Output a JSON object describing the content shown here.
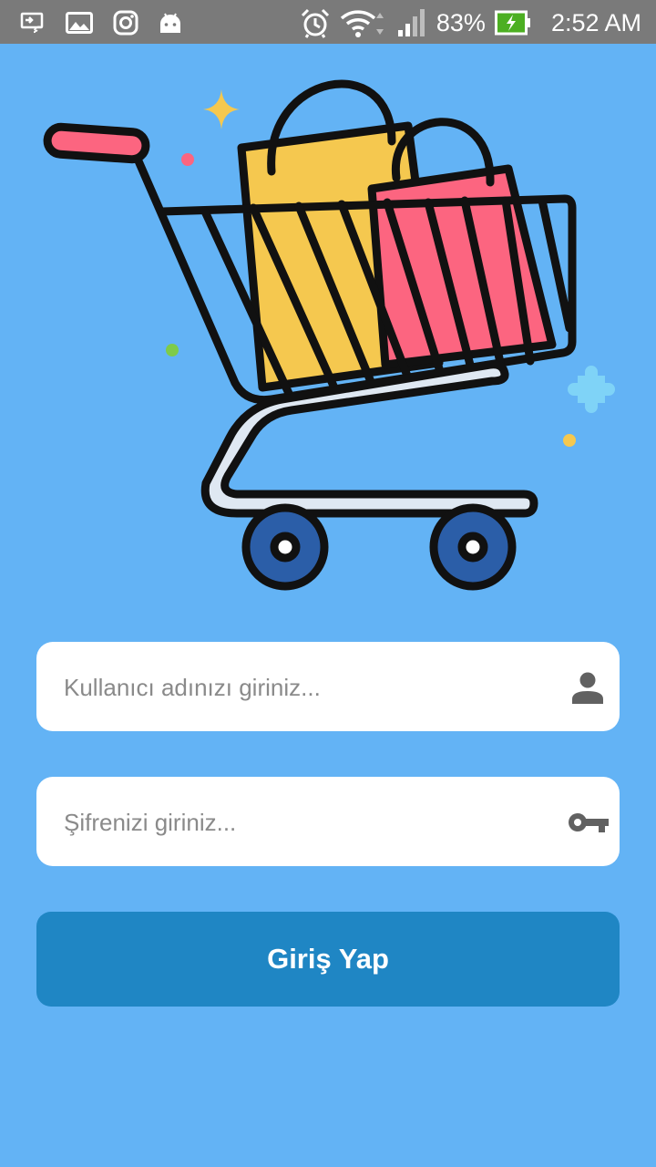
{
  "status_bar": {
    "left_icons": [
      "screen-cast-icon",
      "image-icon",
      "instagram-icon",
      "android-icon"
    ],
    "right_icons": [
      "alarm-icon",
      "wifi-icon",
      "signal-icon",
      "battery-charging-icon"
    ],
    "battery_percent": "83%",
    "time": "2:52 AM"
  },
  "login": {
    "username": {
      "value": "",
      "placeholder": "Kullanıcı adınızı giriniz...",
      "icon": "user-icon"
    },
    "password": {
      "value": "",
      "placeholder": "Şifrenizi giriniz...",
      "icon": "key-icon"
    },
    "submit_label": "Giriş Yap"
  },
  "illustration": {
    "icon": "shopping-cart-icon"
  },
  "colors": {
    "background": "#63b3f5",
    "status_bar": "#7a7a7a",
    "button": "#1f86c4",
    "yellow_bag": "#f5c84f",
    "pink_bag": "#fc6580",
    "wheel": "#2b5ea8"
  }
}
